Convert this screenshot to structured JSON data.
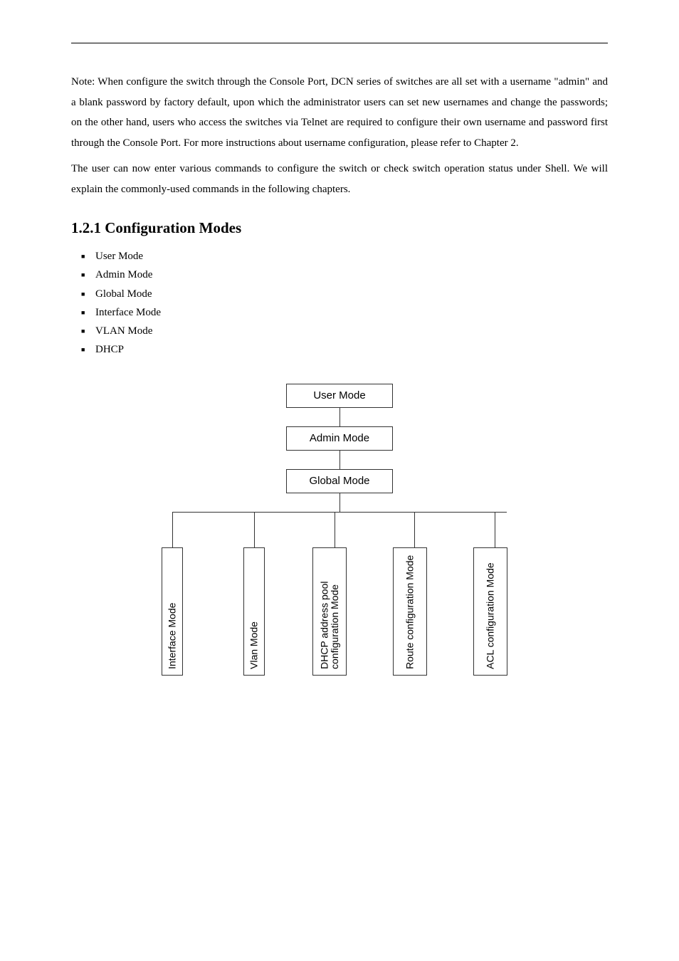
{
  "paragraphs": {
    "p1": "Note: When configure the switch through the Console Port, DCN series of switches are all set with a username \"admin\" and a blank password by factory default, upon which the administrator users can set new usernames and change the passwords; on the other hand, users who access the switches via Telnet are required to configure their own username and password first through the Console Port. For more instructions about username configuration, please refer to Chapter 2.",
    "p2": "The user can now enter various commands to configure the switch or check switch operation status under Shell. We will explain the commonly-used commands in the following chapters."
  },
  "sections": {
    "s1": "1.2.1 Configuration Modes"
  },
  "bullets": [
    "User Mode",
    "Admin Mode",
    "Global Mode",
    "Interface Mode",
    "VLAN Mode",
    "DHCP"
  ],
  "chart_data": {
    "type": "diagram",
    "title": "",
    "nodes": {
      "user": "User Mode",
      "admin": "Admin Mode",
      "global": "Global Mode",
      "interface": "Interface Mode",
      "vlan": "Vlan Mode",
      "dhcp": "DHCP address pool configuration Mode",
      "route": "Route configuration Mode",
      "acl": "ACL configuration Mode"
    },
    "edges": [
      [
        "user",
        "admin"
      ],
      [
        "admin",
        "global"
      ],
      [
        "global",
        "interface"
      ],
      [
        "global",
        "vlan"
      ],
      [
        "global",
        "dhcp"
      ],
      [
        "global",
        "route"
      ],
      [
        "global",
        "acl"
      ]
    ]
  }
}
